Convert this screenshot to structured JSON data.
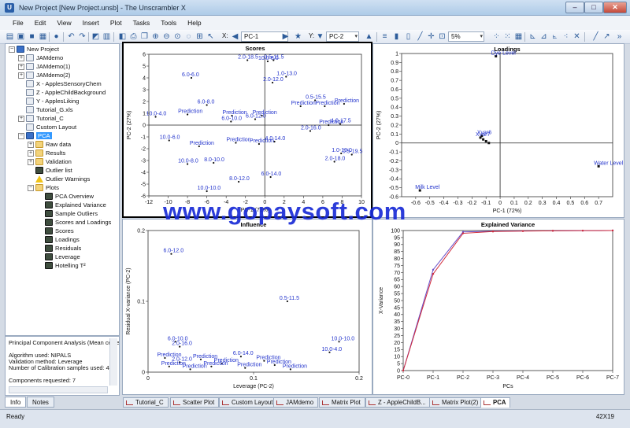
{
  "window": {
    "title": "New Project [New Project.unsb] - The Unscrambler X",
    "app_icon": "unscrambler-icon",
    "minimize": "–",
    "maximize": "□",
    "close": "✕"
  },
  "menu": [
    "File",
    "Edit",
    "View",
    "Insert",
    "Plot",
    "Tasks",
    "Tools",
    "Help"
  ],
  "toolbar": {
    "x_label": "X:",
    "x_value": "PC-1",
    "y_label": "Y:",
    "y_value": "PC-2",
    "zoom_value": "5%"
  },
  "tree": [
    {
      "label": "New Project",
      "icon": "project-icon"
    },
    {
      "label": "JAMdemo",
      "icon": "dataset-icon"
    },
    {
      "label": "JAMdemo(1)",
      "icon": "dataset-icon"
    },
    {
      "label": "JAMdemo(2)",
      "icon": "dataset-icon"
    },
    {
      "label": "X - ApplesSensoryChem",
      "icon": "dataset-icon"
    },
    {
      "label": "Z - AppleChildBackground",
      "icon": "dataset-icon"
    },
    {
      "label": "Y - ApplesLiking",
      "icon": "dataset-icon"
    },
    {
      "label": "Tutorial_G.xls",
      "icon": "dataset-icon"
    },
    {
      "label": "Tutorial_C",
      "icon": "dataset-icon"
    },
    {
      "label": "Custom Layout",
      "icon": "dataset-icon"
    },
    {
      "label": "PCA",
      "icon": "pca-icon"
    },
    {
      "label": "Raw data",
      "icon": "folder-icon"
    },
    {
      "label": "Results",
      "icon": "folder-icon"
    },
    {
      "label": "Validation",
      "icon": "folder-icon"
    },
    {
      "label": "Outlier list",
      "icon": "list-icon"
    },
    {
      "label": "Outlier Warnings",
      "icon": "warning-icon"
    },
    {
      "label": "Plots",
      "icon": "folder-icon"
    },
    {
      "label": "PCA Overview",
      "icon": "plot-icon"
    },
    {
      "label": "Explained Variance",
      "icon": "plot-icon"
    },
    {
      "label": "Sample Outliers",
      "icon": "plot-icon"
    },
    {
      "label": "Scores and Loadings",
      "icon": "plot-icon"
    },
    {
      "label": "Scores",
      "icon": "plot-icon"
    },
    {
      "label": "Loadings",
      "icon": "plot-icon"
    },
    {
      "label": "Residuals",
      "icon": "plot-icon"
    },
    {
      "label": "Leverage",
      "icon": "plot-icon"
    },
    {
      "label": "Hotelling T²",
      "icon": "plot-icon"
    }
  ],
  "info": {
    "lines": [
      "Principal Component Analysis (Mean cente",
      "",
      "Algorithm used: NIPALS",
      "Validation method: Leverage",
      "Number of Calibration samples used: 42",
      "",
      "Components requested: 7"
    ],
    "tabs": [
      "Info",
      "Notes"
    ]
  },
  "chart_data": [
    {
      "type": "scatter",
      "title": "Scores",
      "xlabel": "PC-1 (72%)",
      "ylabel": "PC-2 (27%)",
      "xlim": [
        -12,
        10
      ],
      "ylim": [
        -6,
        6
      ],
      "xticks": [
        -12,
        -10,
        -8,
        -6,
        -4,
        -2,
        0,
        2,
        4,
        6,
        8,
        10
      ],
      "yticks": [
        -6,
        -5,
        -4,
        -3,
        -2,
        -1,
        0,
        1,
        2,
        3,
        4,
        5,
        6
      ],
      "points": [
        {
          "x": -1.8,
          "y": 5.5,
          "label": "2.0-18.5"
        },
        {
          "x": 0.3,
          "y": 5.4,
          "label": "10.0-8.0"
        },
        {
          "x": 0.9,
          "y": 5.5,
          "label": "0.5-11.5"
        },
        {
          "x": -7.6,
          "y": 4.0,
          "label": "6.0-6.0"
        },
        {
          "x": 0.8,
          "y": 3.6,
          "label": "2.0-12.0"
        },
        {
          "x": 2.2,
          "y": 4.1,
          "label": "1.0-13.0"
        },
        {
          "x": -6.0,
          "y": 1.7,
          "label": "6.0-8.0"
        },
        {
          "x": 5.2,
          "y": 2.1,
          "label": "0.5-15.5"
        },
        {
          "x": -8.0,
          "y": 0.9,
          "label": "Prediction"
        },
        {
          "x": -3.4,
          "y": 0.8,
          "label": "Prediction"
        },
        {
          "x": -0.3,
          "y": 0.8,
          "label": "Prediction"
        },
        {
          "x": 3.7,
          "y": 1.6,
          "label": "Prediction"
        },
        {
          "x": 6.2,
          "y": 1.6,
          "label": "Prediction"
        },
        {
          "x": 8.2,
          "y": 1.8,
          "label": "Prediction"
        },
        {
          "x": -11.3,
          "y": 0.7,
          "label": "10.0-4.0"
        },
        {
          "x": -3.5,
          "y": 0.3,
          "label": "6.0-10.0"
        },
        {
          "x": -1.0,
          "y": 0.5,
          "label": "6.0-12.0"
        },
        {
          "x": 6.6,
          "y": 0.0,
          "label": "Prediction"
        },
        {
          "x": 7.8,
          "y": 0.1,
          "label": "4.0-17.5"
        },
        {
          "x": 4.7,
          "y": -0.5,
          "label": "2.0-16.0"
        },
        {
          "x": -9.9,
          "y": -1.3,
          "label": "10.0-6.0"
        },
        {
          "x": -6.8,
          "y": -1.8,
          "label": "Prediction"
        },
        {
          "x": -3.0,
          "y": -1.5,
          "label": "Prediction"
        },
        {
          "x": -0.6,
          "y": -1.6,
          "label": "Prediction"
        },
        {
          "x": 1.0,
          "y": -1.4,
          "label": "4.0-14.0"
        },
        {
          "x": 7.9,
          "y": -2.4,
          "label": "1.0-19.0"
        },
        {
          "x": 7.2,
          "y": -3.1,
          "label": "2.0-18.0"
        },
        {
          "x": 9.0,
          "y": -2.5,
          "label": "0.5-19.5"
        },
        {
          "x": -8.0,
          "y": -3.3,
          "label": "10.0-8.0"
        },
        {
          "x": -5.3,
          "y": -3.2,
          "label": "8.0-10.0"
        },
        {
          "x": 0.6,
          "y": -4.4,
          "label": "6.0-14.0"
        },
        {
          "x": -2.7,
          "y": -4.8,
          "label": "8.0-12.0"
        },
        {
          "x": -6.0,
          "y": -5.6,
          "label": "10.0-10.0"
        }
      ]
    },
    {
      "type": "scatter",
      "title": "Loadings",
      "xlabel": "PC-1 (72%)",
      "ylabel": "PC-2 (27%)",
      "xlim": [
        -0.7,
        0.8
      ],
      "ylim": [
        -0.6,
        1.0
      ],
      "xticks": [
        -0.6,
        -0.5,
        -0.4,
        -0.3,
        -0.2,
        -0.1,
        0,
        0.1,
        0.2,
        0.3,
        0.4,
        0.5,
        0.6,
        0.7
      ],
      "yticks": [
        -0.6,
        -0.5,
        -0.4,
        -0.3,
        -0.2,
        -0.1,
        0,
        0.1,
        0.2,
        0.3,
        0.4,
        0.5,
        0.6,
        0.7,
        0.8,
        0.9,
        1.0
      ],
      "points": [
        {
          "x": -0.03,
          "y": 0.97,
          "label": "Dye Level"
        },
        {
          "x": -0.13,
          "y": 0.08,
          "label": "Xvar6"
        },
        {
          "x": -0.14,
          "y": 0.06,
          "label": "Xvar7"
        },
        {
          "x": -0.12,
          "y": 0.04,
          "label": ""
        },
        {
          "x": -0.1,
          "y": 0.02,
          "label": ""
        },
        {
          "x": -0.08,
          "y": 0.0,
          "label": ""
        },
        {
          "x": 0.7,
          "y": -0.26,
          "label": "Water Level"
        },
        {
          "x": -0.57,
          "y": -0.53,
          "label": "Milk Level"
        }
      ]
    },
    {
      "type": "scatter",
      "title": "Influence",
      "xlabel": "Leverage (PC-2)",
      "ylabel": "Residual X-variance (PC-2)",
      "xlim": [
        0,
        0.2
      ],
      "ylim": [
        0,
        0.2
      ],
      "xticks": [
        0,
        0.1,
        0.2
      ],
      "yticks": [
        0,
        0.1,
        0.2
      ],
      "points": [
        {
          "x": 0.022,
          "y": 0.167,
          "label": "6.0-12.0"
        },
        {
          "x": 0.132,
          "y": 0.1,
          "label": "0.5-11.5"
        },
        {
          "x": 0.181,
          "y": 0.043,
          "label": "10.0-10.0"
        },
        {
          "x": 0.026,
          "y": 0.043,
          "label": "6.0-10.0"
        },
        {
          "x": 0.03,
          "y": 0.036,
          "label": "2.0-16.0"
        },
        {
          "x": 0.172,
          "y": 0.028,
          "label": "10.0-4.0"
        },
        {
          "x": 0.088,
          "y": 0.022,
          "label": "6.0-14.0"
        },
        {
          "x": 0.016,
          "y": 0.02,
          "label": "Prediction"
        },
        {
          "x": 0.05,
          "y": 0.018,
          "label": "Prediction"
        },
        {
          "x": 0.11,
          "y": 0.016,
          "label": "Prediction"
        },
        {
          "x": 0.03,
          "y": 0.014,
          "label": "2.0-12.0"
        },
        {
          "x": 0.07,
          "y": 0.012,
          "label": "Prediction"
        },
        {
          "x": 0.12,
          "y": 0.01,
          "label": "Prediction"
        },
        {
          "x": 0.02,
          "y": 0.008,
          "label": "Prediction"
        },
        {
          "x": 0.06,
          "y": 0.008,
          "label": "Prediction"
        },
        {
          "x": 0.092,
          "y": 0.006,
          "label": "Prediction"
        },
        {
          "x": 0.135,
          "y": 0.004,
          "label": "Prediction"
        },
        {
          "x": 0.04,
          "y": 0.004,
          "label": "Prediction"
        }
      ]
    },
    {
      "type": "line",
      "title": "Explained Variance",
      "xlabel": "PCs",
      "ylabel": "X-Variance",
      "categories": [
        "PC-0",
        "PC-1",
        "PC-2",
        "PC-3",
        "PC-4",
        "PC-5",
        "PC-6",
        "PC-7"
      ],
      "ylim": [
        0,
        100
      ],
      "yticks": [
        0,
        5,
        10,
        15,
        20,
        25,
        30,
        35,
        40,
        45,
        50,
        55,
        60,
        65,
        70,
        75,
        80,
        85,
        90,
        95,
        100
      ],
      "series": [
        {
          "color": "#6a4fc8",
          "values": [
            0,
            72,
            99,
            99.5,
            99.7,
            99.8,
            99.9,
            100
          ]
        },
        {
          "color": "#d02a3a",
          "values": [
            0,
            69,
            98,
            99.3,
            99.6,
            99.8,
            99.9,
            100
          ]
        }
      ]
    }
  ],
  "doc_tabs": [
    "Tutorial_C",
    "Scatter Plot",
    "Custom Layout",
    "JAMdemo",
    "Matrix Plot",
    "Z - AppleChildB...",
    "Matrix Plot(2)",
    "PCA"
  ],
  "status": {
    "text": "Ready",
    "dimensions": "42X19"
  },
  "watermark": "www.gopaysoft.com",
  "colors": {
    "point_label": "#2233cc",
    "accent": "#3399ff",
    "watermark": "#1a2cd6"
  }
}
